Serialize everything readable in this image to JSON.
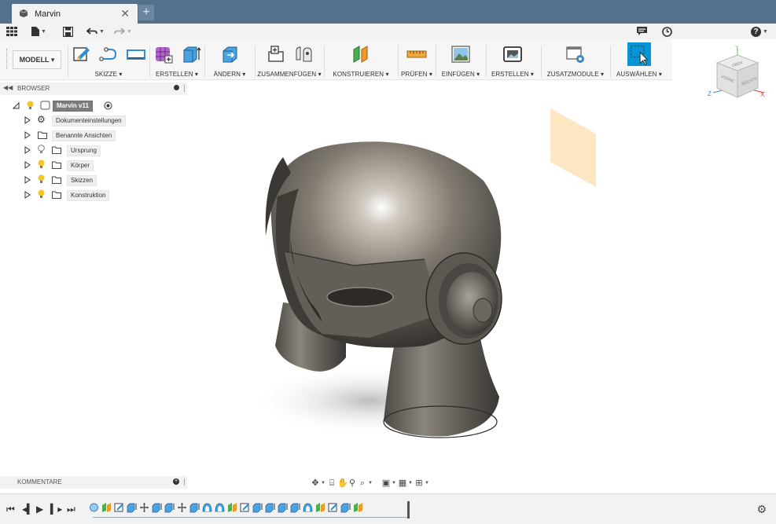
{
  "tab": {
    "title": "Marvin",
    "close": "✕",
    "new": "+"
  },
  "qat": {
    "apps": "grid-icon",
    "file": "file-icon",
    "save": "save-icon",
    "undo": "undo-icon",
    "redo": "redo-icon",
    "notifications": "chat-icon",
    "history": "clock-icon",
    "help": "?"
  },
  "ribbon": {
    "workspace": "MODELL ▾",
    "groups": [
      {
        "label": "SKIZZE ▾",
        "icons": [
          "sketch-icon",
          "arc-icon",
          "rectangle-icon"
        ]
      },
      {
        "label": "ERSTELLEN ▾",
        "icons": [
          "form-icon",
          "extrude-icon"
        ]
      },
      {
        "label": "ÄNDERN ▾",
        "icons": [
          "press-pull-icon"
        ]
      },
      {
        "label": "ZUSAMMENFÜGEN ▾",
        "icons": [
          "new-component-icon",
          "joint-icon"
        ]
      },
      {
        "label": "KONSTRUIEREN ▾",
        "icons": [
          "offset-plane-icon"
        ]
      },
      {
        "label": "PRÜFEN ▾",
        "icons": [
          "measure-icon"
        ]
      },
      {
        "label": "EINFÜGEN ▾",
        "icons": [
          "insert-image-icon"
        ]
      },
      {
        "label": "ERSTELLEN ▾",
        "icons": [
          "render-icon"
        ]
      },
      {
        "label": "ZUSATZMODULE ▾",
        "icons": [
          "scripts-icon"
        ]
      },
      {
        "label": "AUSWÄHLEN ▾",
        "icons": [
          "select-icon"
        ]
      }
    ]
  },
  "browser": {
    "title": "BROWSER",
    "root": "Marvin v11",
    "items": [
      {
        "label": "Dokumenteinstellungen",
        "icon": "gear-icon"
      },
      {
        "label": "Benannte Ansichten",
        "icon": "folder-icon"
      },
      {
        "label": "Ursprung",
        "icon": "folder-icon"
      },
      {
        "label": "Körper",
        "icon": "folder-icon"
      },
      {
        "label": "Skizzen",
        "icon": "folder-icon"
      },
      {
        "label": "Konstruktion",
        "icon": "folder-icon"
      }
    ]
  },
  "comments": {
    "title": "KOMMENTARE"
  },
  "viewcube": {
    "top": "OBEN",
    "front": "VORNE",
    "right": "RECHTS",
    "x": "X",
    "y": "Y",
    "z": "Z"
  },
  "colors": {
    "tabbar": "#54708b",
    "accent": "#0696d7",
    "bulb": "#f3c623",
    "plane": "#fde4bb"
  }
}
